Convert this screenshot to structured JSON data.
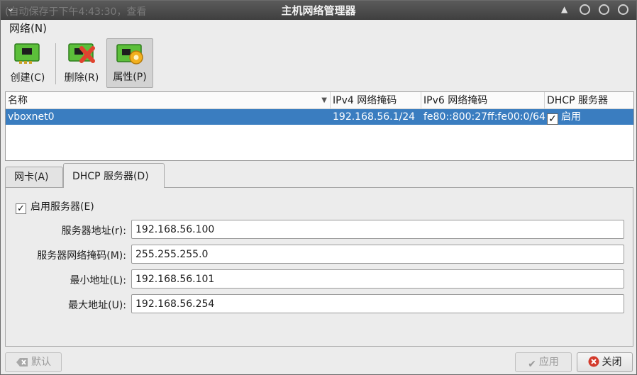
{
  "window": {
    "title": "主机网络管理器",
    "ghost_text": "(自动保存于下午4:43:30，查看"
  },
  "menubar": {
    "network": "网络(N)"
  },
  "toolbar": {
    "create": "创建(C)",
    "delete": "删除(R)",
    "properties": "属性(P)"
  },
  "table": {
    "columns": [
      "名称",
      "IPv4 网络掩码",
      "IPv6 网络掩码",
      "DHCP 服务器"
    ],
    "rows": [
      {
        "name": "vboxnet0",
        "ipv4": "192.168.56.1/24",
        "ipv6": "fe80::800:27ff:fe00:0/64",
        "dhcp": "启用",
        "dhcp_checked": true
      }
    ]
  },
  "tabs": {
    "adapter": "网卡(A)",
    "dhcp": "DHCP 服务器(D)",
    "active": "dhcp"
  },
  "dhcp_panel": {
    "enable_label": "启用服务器(E)",
    "enable_checked": true,
    "fields": [
      {
        "label": "服务器地址(r):",
        "value": "192.168.56.100"
      },
      {
        "label": "服务器网络掩码(M):",
        "value": "255.255.255.0"
      },
      {
        "label": "最小地址(L):",
        "value": "192.168.56.101"
      },
      {
        "label": "最大地址(U):",
        "value": "192.168.56.254"
      }
    ]
  },
  "buttons": {
    "default": "默认",
    "apply": "应用",
    "close": "关闭"
  },
  "colors": {
    "titlebar": "#4a4a4a",
    "selection": "#3a7dc0",
    "close_red": "#d33a2c"
  }
}
